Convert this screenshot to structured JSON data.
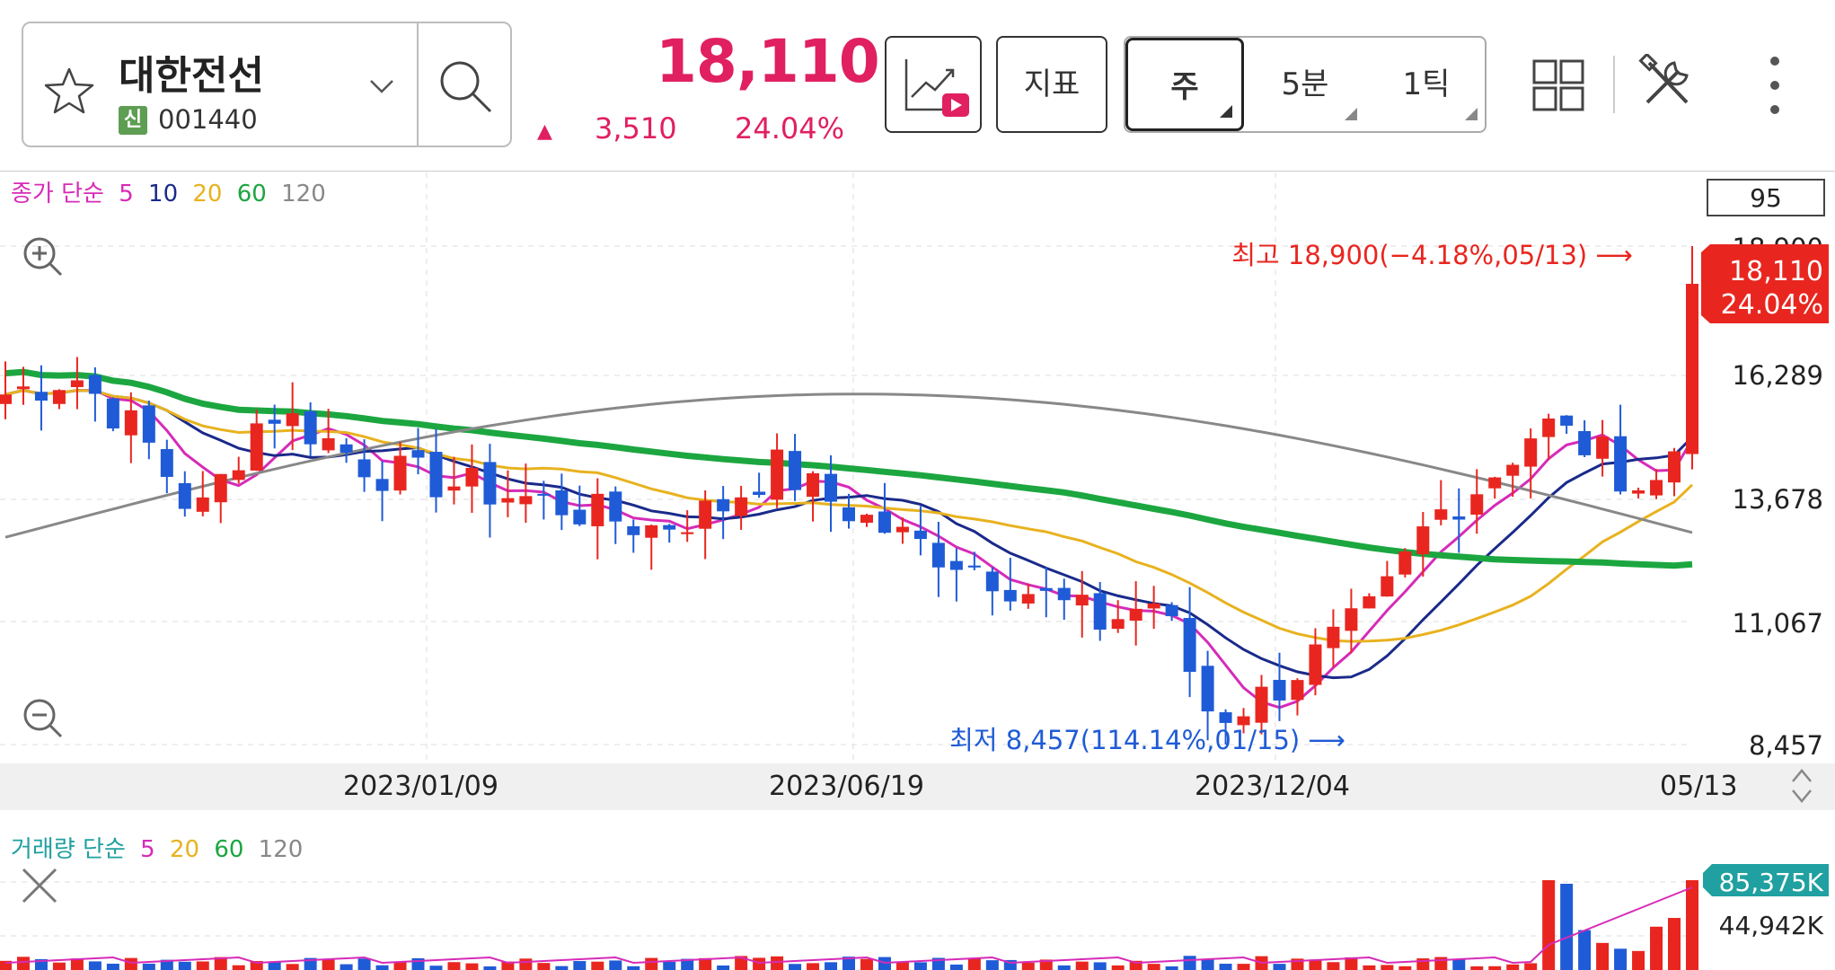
{
  "header": {
    "stock_name": "대한전선",
    "badge": "신",
    "stock_code": "001440",
    "price": "18,110",
    "change_arrow": "▲",
    "change": "3,510",
    "change_pct": "24.04%",
    "accent_color": "#e02060"
  },
  "toolbar": {
    "indicator_label": "지표",
    "tabs": [
      {
        "label": "주",
        "selected": true
      },
      {
        "label": "5분",
        "selected": false
      },
      {
        "label": "1틱",
        "selected": false
      }
    ],
    "icons": [
      "star-icon",
      "chevron-down-icon",
      "search-icon",
      "chart-video-icon",
      "grid-layout-icon",
      "tools-icon",
      "more-vertical-icon"
    ]
  },
  "main_chart": {
    "ma_legend": {
      "prefix": "종가 단순",
      "periods": [
        "5",
        "10",
        "20",
        "60",
        "120"
      ]
    },
    "visible_count": "95",
    "high_annotation": "최고 18,900(−4.18%,05/13) ⟶",
    "low_annotation": "최저 8,457(114.14%,01/15) ⟶",
    "price_tag": {
      "price": "18,110",
      "pct": "24.04%"
    },
    "y_ticks": [
      "18,900",
      "16,289",
      "13,678",
      "11,067",
      "8,457"
    ],
    "x_ticks": [
      "2023/01/09",
      "2023/06/19",
      "2023/12/04",
      "05/13"
    ]
  },
  "volume_chart": {
    "legend": {
      "prefix": "거래량 단순",
      "periods": [
        "5",
        "20",
        "60",
        "120"
      ]
    },
    "tag": "85,375K",
    "y_tick": "44,942K"
  },
  "chart_data": {
    "type": "candlestick",
    "interval": "weekly",
    "ylim": [
      8457,
      18900
    ],
    "high": {
      "value": 18900,
      "date": "05/13"
    },
    "low": {
      "value": 8457,
      "date": "01/15"
    },
    "last": {
      "close": 18110,
      "change": 3510,
      "change_pct": 24.04
    },
    "colors": {
      "up": "#e8261f",
      "down": "#1f5bd6",
      "ma5": "#d62bb8",
      "ma10": "#1a2a8a",
      "ma20": "#e8b21f",
      "ma60": "#1ca640",
      "ma120": "#888888"
    }
  }
}
